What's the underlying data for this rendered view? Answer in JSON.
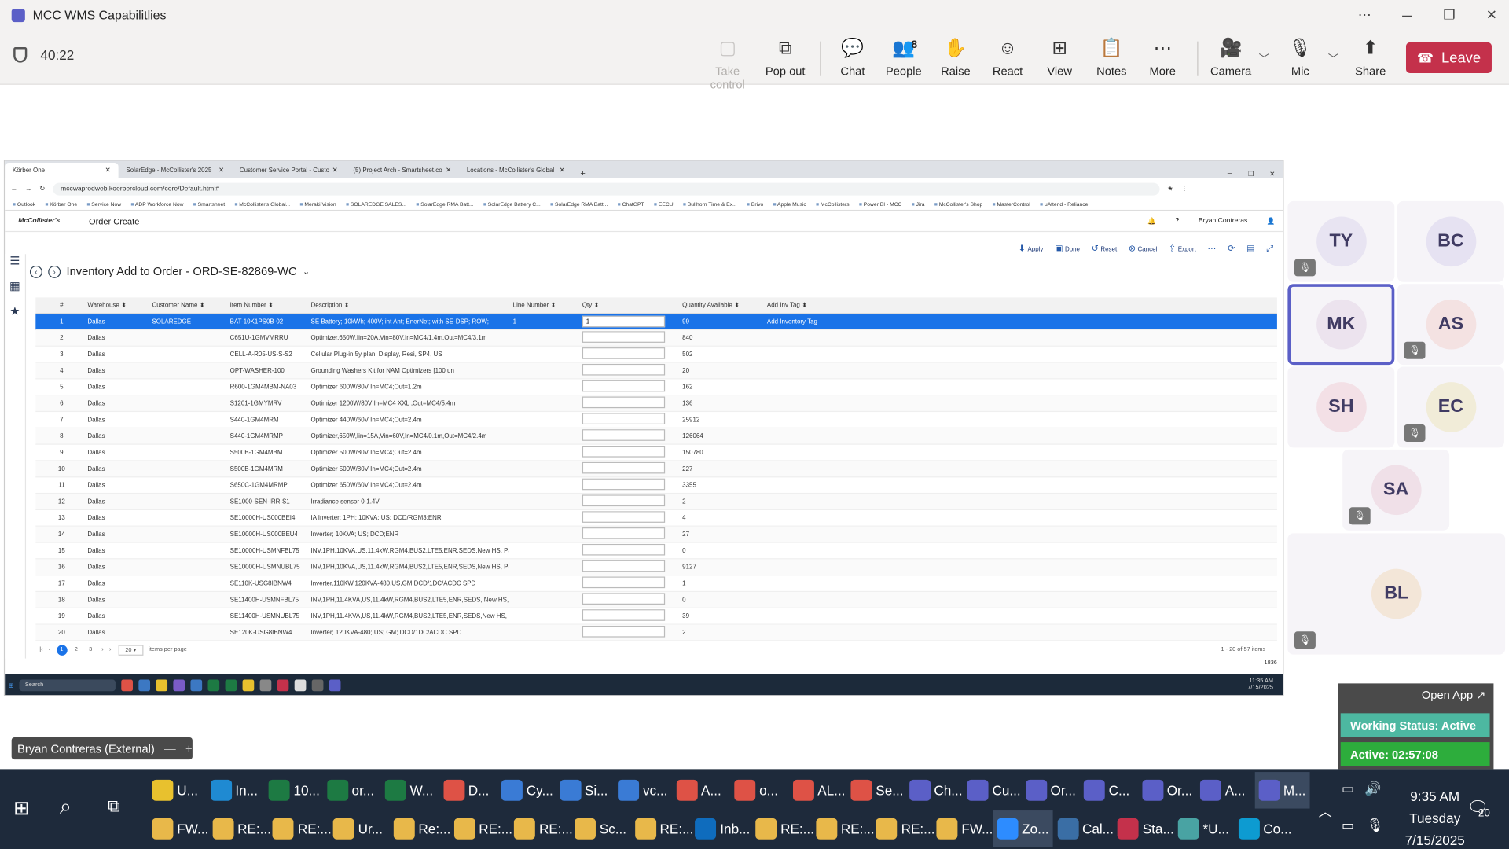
{
  "window": {
    "title": "MCC WMS Capabilitlies",
    "controls": [
      "⋯",
      "─",
      "❐",
      "✕"
    ]
  },
  "meeting": {
    "timer": "40:22",
    "toolbar": [
      {
        "label": "Take control",
        "icon": "▢",
        "name": "take-control"
      },
      {
        "label": "Pop out",
        "icon": "⧉",
        "name": "pop-out"
      },
      {
        "label": "Chat",
        "icon": "💬",
        "name": "chat"
      },
      {
        "label": "People",
        "icon": "👥",
        "count": "8",
        "name": "people"
      },
      {
        "label": "Raise",
        "icon": "✋",
        "name": "raise"
      },
      {
        "label": "React",
        "icon": "☺",
        "name": "react"
      },
      {
        "label": "View",
        "icon": "⊞",
        "name": "view"
      },
      {
        "label": "Notes",
        "icon": "📋",
        "name": "notes"
      },
      {
        "label": "More",
        "icon": "⋯",
        "name": "more"
      },
      {
        "label": "Camera",
        "icon": "🎥",
        "name": "camera"
      },
      {
        "label": "Mic",
        "icon": "🎙",
        "name": "mic"
      },
      {
        "label": "Share",
        "icon": "⬆",
        "name": "share"
      }
    ],
    "leave": "Leave"
  },
  "browser": {
    "tabs": [
      {
        "label": "Körber One"
      },
      {
        "label": "SolarEdge - McCollister's 2025"
      },
      {
        "label": "Customer Service Portal - Custo"
      },
      {
        "label": "(5) Project Arch - Smartsheet.co"
      },
      {
        "label": "Locations - McCollister's Global"
      }
    ],
    "new_tab": "+",
    "url": "mccwaprodweb.koerbercloud.com/core/Default.html#",
    "bookmarks": [
      "Outlook",
      "Körber One",
      "Service Now",
      "ADP Workforce Now",
      "Smartsheet",
      "McCollister's Global...",
      "Meraki Vision",
      "SOLAREDGE SALES...",
      "SolarEdge RMA Batt...",
      "SolarEdge Battery C...",
      "SolarEdge RMA Batt...",
      "ChatGPT",
      "EECU",
      "Bullhorn Time & Ex...",
      "Brivo",
      "Apple Music",
      "McCollisters",
      "Power BI - MCC",
      "Jira",
      "McCollister's Shop",
      "MasterControl",
      "uAttend - Reliance"
    ]
  },
  "app": {
    "brand": "McCollister's",
    "page_name": "Order Create",
    "user": "Bryan Contreras",
    "title": "Inventory Add to Order - ORD-SE-82869-WC",
    "actions": [
      {
        "label": "Apply"
      },
      {
        "label": "Done"
      },
      {
        "label": "Reset"
      },
      {
        "label": "Cancel"
      },
      {
        "label": "Export"
      }
    ],
    "columns": [
      "#",
      "Warehouse",
      "Customer Name",
      "Item Number",
      "Description",
      "Line Number",
      "Qty",
      "Quantity Available",
      "Add Inv Tag"
    ],
    "rows": [
      [
        "1",
        "Dallas",
        "SOLAREDGE",
        "BAT-10K1PS0B-02",
        "SE Battery; 10kWh; 400V; int Ant; EnerNet; with SE-DSP; ROW;",
        "1",
        "1",
        "99",
        "Add Inventory Tag"
      ],
      [
        "2",
        "Dallas",
        "",
        "C651U-1GMVMRRU",
        "Optimizer,650W,Iin=20A,Vin=80V,In=MC4/1.4m,Out=MC4/3.1m",
        "",
        "",
        "840",
        ""
      ],
      [
        "3",
        "Dallas",
        "",
        "CELL-A-R05-US-S-S2",
        "Cellular Plug-in 5y plan, Display, Resi, SP4, US",
        "",
        "",
        "502",
        ""
      ],
      [
        "4",
        "Dallas",
        "",
        "OPT-WASHER-100",
        "Grounding Washers Kit for NAM Optimizers [100 un",
        "",
        "",
        "20",
        ""
      ],
      [
        "5",
        "Dallas",
        "",
        "R600-1GM4MBM-NA03",
        "Optimizer 600W/80V In=MC4;Out=1.2m",
        "",
        "",
        "162",
        ""
      ],
      [
        "6",
        "Dallas",
        "",
        "S1201-1GMYMRV",
        "Optimizer 1200W/80V In=MC4 XXL ;Out=MC4/5.4m",
        "",
        "",
        "136",
        ""
      ],
      [
        "7",
        "Dallas",
        "",
        "S440-1GM4MRM",
        "Optimizer 440W/60V In=MC4;Out=2.4m",
        "",
        "",
        "25912",
        ""
      ],
      [
        "8",
        "Dallas",
        "",
        "S440-1GM4MRMP",
        "Optimizer,650W,Iin=15A,Vin=60V,In=MC4/0.1m,Out=MC4/2.4m",
        "",
        "",
        "126064",
        ""
      ],
      [
        "9",
        "Dallas",
        "",
        "S500B-1GM4MBM",
        "Optimizer 500W/80V In=MC4;Out=2.4m",
        "",
        "",
        "150780",
        ""
      ],
      [
        "10",
        "Dallas",
        "",
        "S500B-1GM4MRM",
        "Optimizer 500W/80V In=MC4;Out=2.4m",
        "",
        "",
        "227",
        ""
      ],
      [
        "11",
        "Dallas",
        "",
        "S650C-1GM4MRMP",
        "Optimizer 650W/60V In=MC4;Out=2.4m",
        "",
        "",
        "3355",
        ""
      ],
      [
        "12",
        "Dallas",
        "",
        "SE1000-SEN-IRR-S1",
        "Irradiance sensor 0-1.4V",
        "",
        "",
        "2",
        ""
      ],
      [
        "13",
        "Dallas",
        "",
        "SE10000H-US000BEI4",
        "IA Inverter; 1PH; 10KVA; US; DCD/RGM3;ENR",
        "",
        "",
        "4",
        ""
      ],
      [
        "14",
        "Dallas",
        "",
        "SE10000H-US000BEU4",
        "Inverter; 10KVA; US; DCD;ENR",
        "",
        "",
        "27",
        ""
      ],
      [
        "15",
        "Dallas",
        "",
        "SE10000H-USMNFBL75",
        "INV,1PH,10KVA,US,11.4kW,RGM4,BUS2,LTE5,ENR,SEDS,New HS, Par",
        "",
        "",
        "0",
        ""
      ],
      [
        "16",
        "Dallas",
        "",
        "SE10000H-USMNUBL75",
        "INV,1PH,10KVA,US,11.4kW,RGM4,BUS2,LTE5,ENR,SEDS,New HS, Part",
        "",
        "",
        "9127",
        ""
      ],
      [
        "17",
        "Dallas",
        "",
        "SE110K-USG8IBNW4",
        "Inverter,110KW,120KVA-480,US,GM,DCD/1DC/ACDC SPD",
        "",
        "",
        "1",
        ""
      ],
      [
        "18",
        "Dallas",
        "",
        "SE11400H-USMNFBL75",
        "INV,1PH,11.4KVA,US,11.4kW,RGM4,BUS2,LTE5,ENR,SEDS, New HS, P",
        "",
        "",
        "0",
        ""
      ],
      [
        "19",
        "Dallas",
        "",
        "SE11400H-USMNUBL75",
        "INV,1PH,11.4KVA,US,11.4kW,RGM4,BUS2,LTE5,ENR,SEDS,New HS, Pa",
        "",
        "",
        "39",
        ""
      ],
      [
        "20",
        "Dallas",
        "",
        "SE120K-USG8IBNW4",
        "Inverter; 120KVA-480; US; GM; DCD/1DC/ACDC SPD",
        "",
        "",
        "2",
        ""
      ]
    ],
    "pager": {
      "pages": [
        "1",
        "2",
        "3"
      ],
      "per_page": "20",
      "per_page_label": "items per page",
      "info": "1 - 20 of 57 items"
    },
    "footer_num": "1836"
  },
  "mini_taskbar": {
    "search": "Search",
    "time": "11:35 AM",
    "date": "7/15/2025"
  },
  "participants": [
    {
      "initials": "TY",
      "color": "#e8e4f2",
      "muted": true
    },
    {
      "initials": "BC",
      "color": "#e6e2f2",
      "muted": false
    },
    {
      "initials": "MK",
      "color": "#ece3ee",
      "muted": false,
      "speaking": true
    },
    {
      "initials": "AS",
      "color": "#f4e2e2",
      "muted": true
    },
    {
      "initials": "SH",
      "color": "#f3e0e6",
      "muted": false
    },
    {
      "initials": "EC",
      "color": "#f1ecd8",
      "muted": true
    },
    {
      "initials": "SA",
      "color": "#f0e0e8",
      "muted": true
    },
    {
      "initials": "BL",
      "color": "#f3e6d8",
      "muted": true
    }
  ],
  "presenter": {
    "name": "Bryan Contreras (External)"
  },
  "status_widget": {
    "open_app": "Open App ↗",
    "working": "Working Status: Active",
    "active": "Active: 02:57:08"
  },
  "taskbar": {
    "row1": [
      {
        "label": "U...",
        "color": "#e8c12e"
      },
      {
        "label": "In...",
        "color": "#1f8ad2"
      },
      {
        "label": "10...",
        "color": "#1d7a43"
      },
      {
        "label": "or...",
        "color": "#1d7a43"
      },
      {
        "label": "W...",
        "color": "#1d7a43"
      },
      {
        "label": "D...",
        "color": "#de5246"
      },
      {
        "label": "Cy...",
        "color": "#3a7bd5"
      },
      {
        "label": "Si...",
        "color": "#3a7bd5"
      },
      {
        "label": "vc...",
        "color": "#3a7bd5"
      },
      {
        "label": "A...",
        "color": "#de5246"
      },
      {
        "label": "o...",
        "color": "#de5246"
      },
      {
        "label": "AL...",
        "color": "#de5246"
      },
      {
        "label": "Se...",
        "color": "#de5246"
      },
      {
        "label": "Ch...",
        "color": "#5b5fc7"
      },
      {
        "label": "Cu...",
        "color": "#5b5fc7"
      },
      {
        "label": "Or...",
        "color": "#5b5fc7"
      },
      {
        "label": "C...",
        "color": "#5b5fc7"
      },
      {
        "label": "Or...",
        "color": "#5b5fc7"
      },
      {
        "label": "A...",
        "color": "#5b5fc7"
      },
      {
        "label": "M...",
        "color": "#5b5fc7"
      }
    ],
    "row2": [
      {
        "label": "FW...",
        "color": "#e8b84a"
      },
      {
        "label": "RE:...",
        "color": "#e8b84a"
      },
      {
        "label": "RE:...",
        "color": "#e8b84a"
      },
      {
        "label": "Ur...",
        "color": "#e8b84a"
      },
      {
        "label": "Re:...",
        "color": "#e8b84a"
      },
      {
        "label": "RE:...",
        "color": "#e8b84a"
      },
      {
        "label": "RE:...",
        "color": "#e8b84a"
      },
      {
        "label": "Sc...",
        "color": "#e8b84a"
      },
      {
        "label": "RE:...",
        "color": "#e8b84a"
      },
      {
        "label": "Inb...",
        "color": "#0f6cbd"
      },
      {
        "label": "RE:...",
        "color": "#e8b84a"
      },
      {
        "label": "RE:...",
        "color": "#e8b84a"
      },
      {
        "label": "RE:...",
        "color": "#e8b84a"
      },
      {
        "label": "FW...",
        "color": "#e8b84a"
      },
      {
        "label": "Zo...",
        "color": "#2d8cff"
      },
      {
        "label": "Cal...",
        "color": "#3a6ea5"
      },
      {
        "label": "Sta...",
        "color": "#c4314b"
      },
      {
        "label": "*U...",
        "color": "#49a3a3"
      },
      {
        "label": "Co...",
        "color": "#0d9bd1"
      }
    ],
    "clock": {
      "time": "9:35 AM",
      "day": "Tuesday",
      "date": "7/15/2025"
    },
    "notifications": "20"
  }
}
